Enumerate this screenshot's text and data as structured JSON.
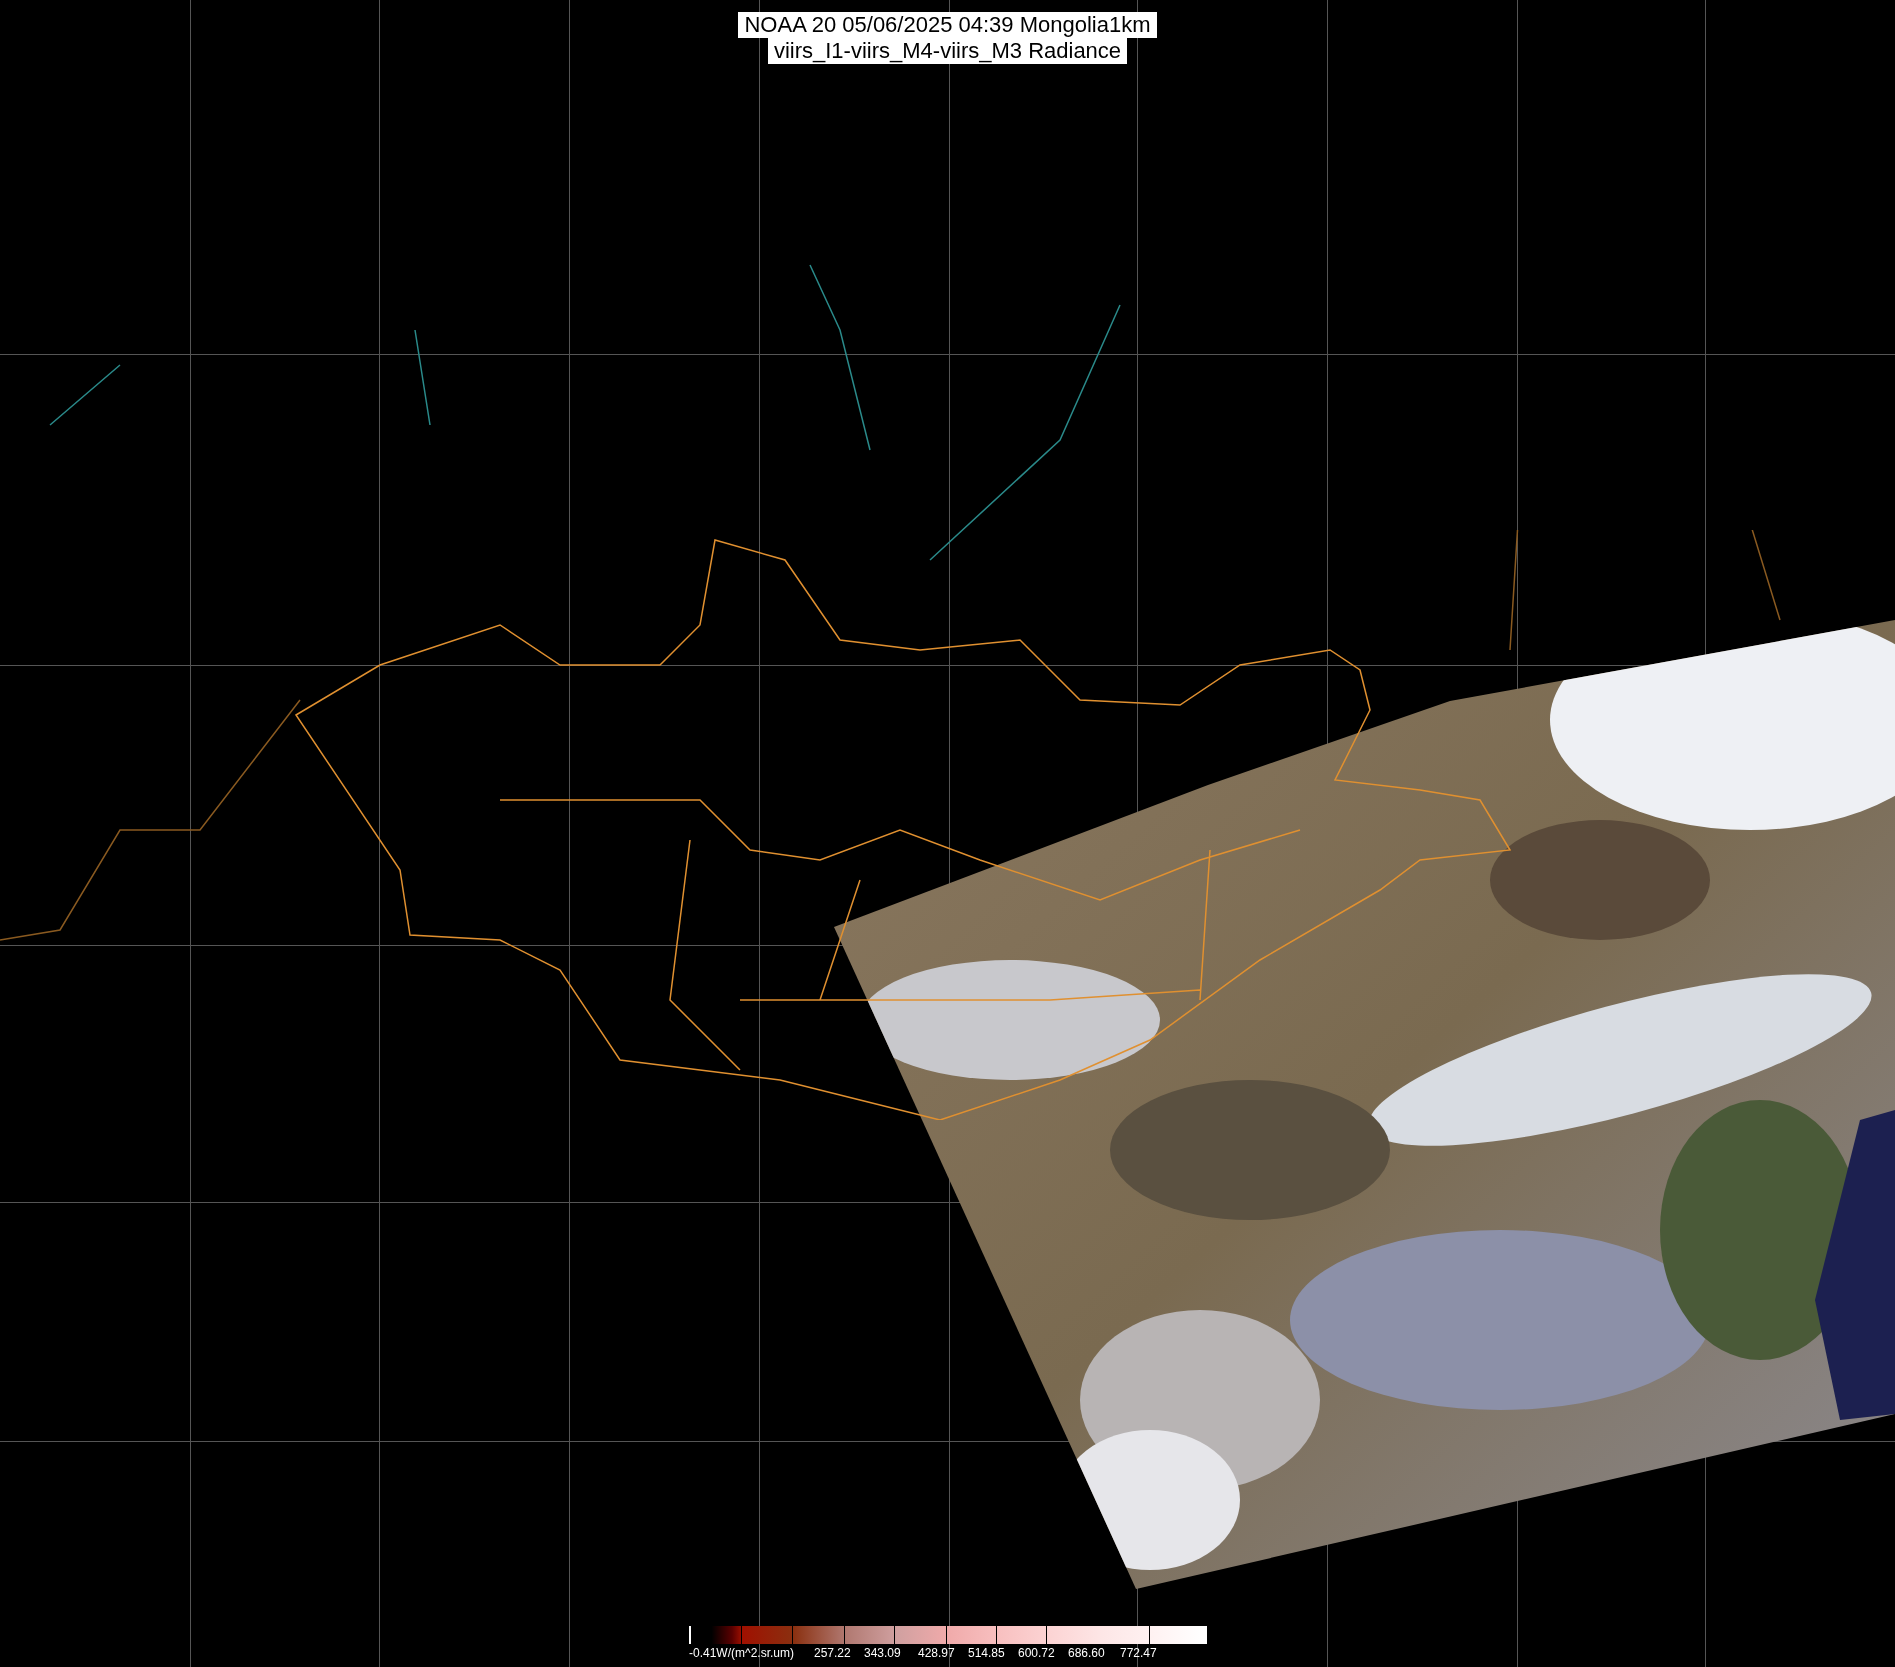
{
  "title": {
    "lines": [
      "NOAA 20 05/06/2025 04:39 Mongolia1km",
      "viirs_I1-viirs_M4-viirs_M3 Radiance"
    ]
  },
  "colorbar": {
    "labels": [
      "-0.41W/(m^2.sr.um)",
      "257.22",
      "343.09",
      "428.97",
      "514.85",
      "600.72",
      "686.60",
      "772.47"
    ]
  }
}
